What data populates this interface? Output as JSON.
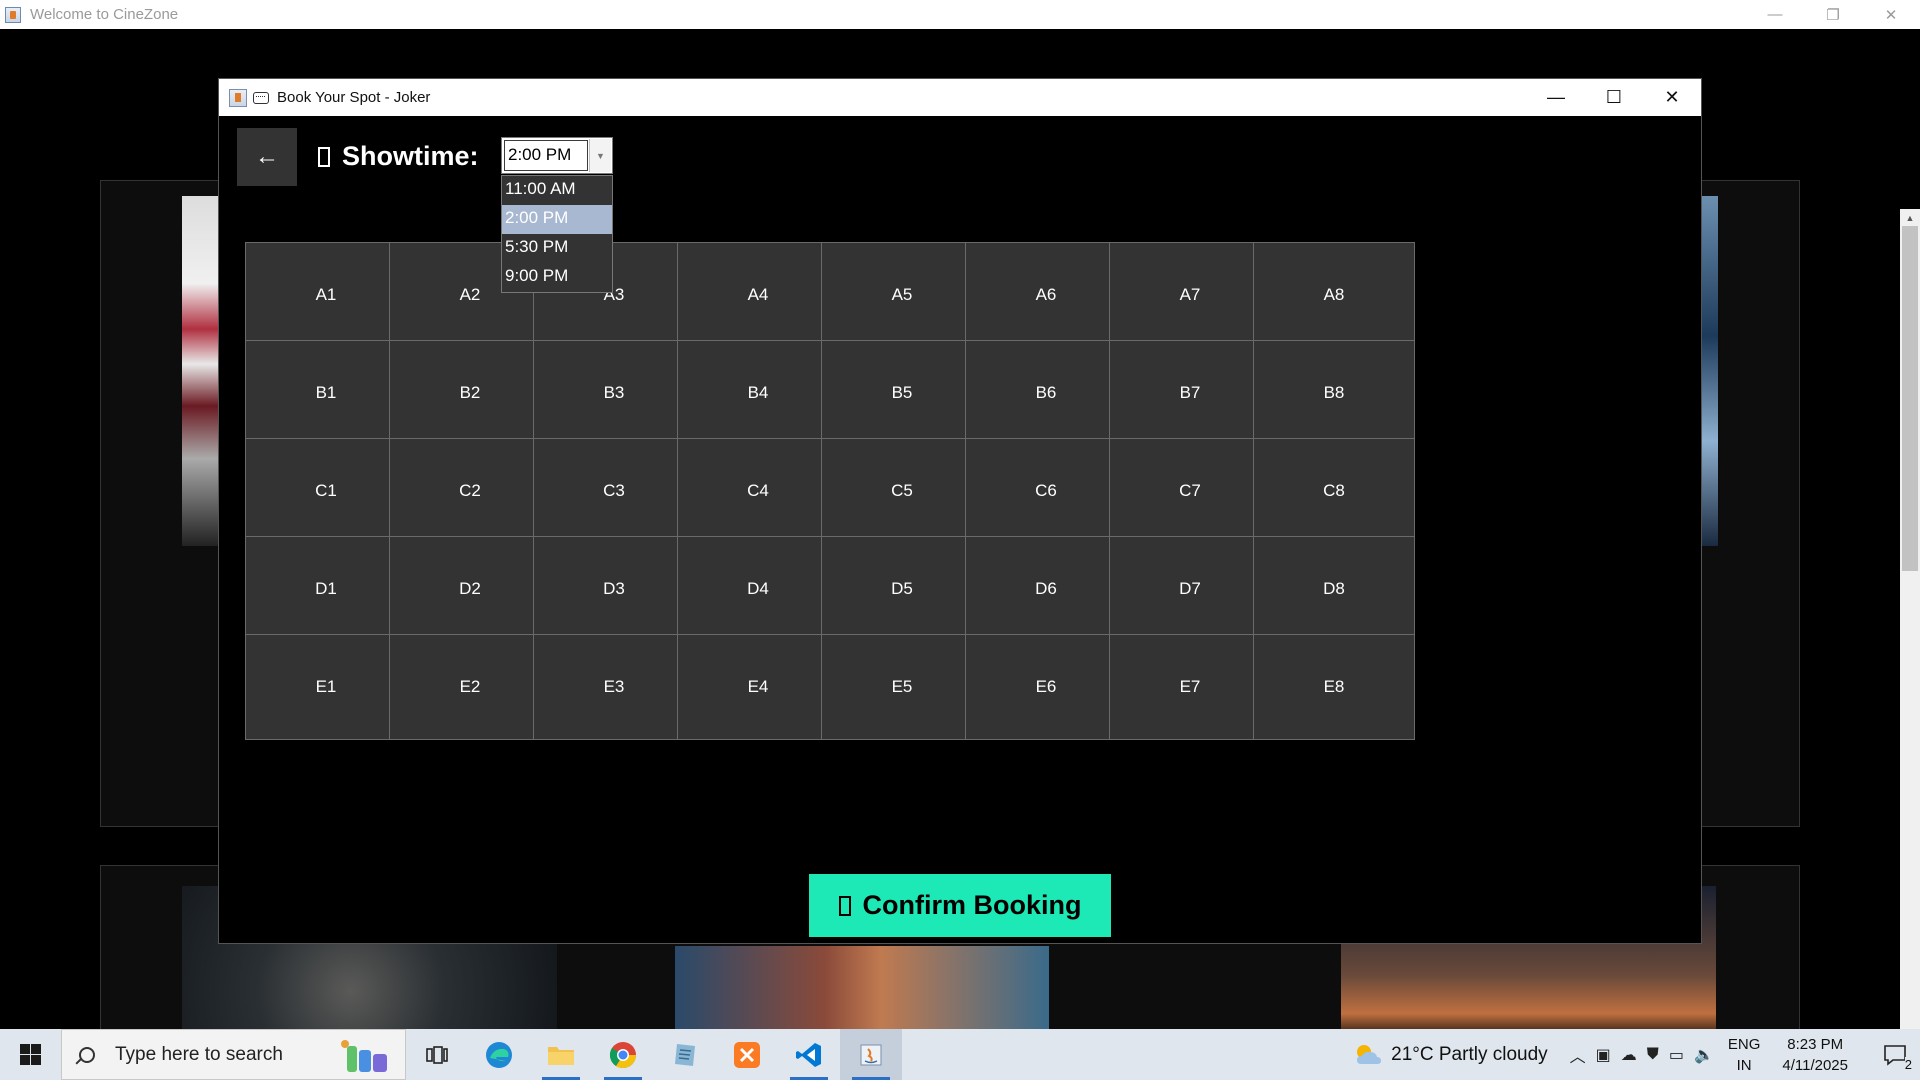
{
  "outer_window": {
    "title": "Welcome to CineZone",
    "controls": {
      "minimize": "—",
      "restore": "❐",
      "close": "✕"
    }
  },
  "dialog": {
    "title": "Book Your Spot - Joker",
    "controls": {
      "minimize": "—",
      "maximize": "☐",
      "close": "✕"
    },
    "back_label": "←",
    "showtime_label": "Showtime:",
    "showtime_selected": "2:00 PM",
    "showtime_options": [
      "11:00 AM",
      "2:00 PM",
      "5:30 PM",
      "9:00 PM"
    ],
    "seat_rows": [
      [
        "A1",
        "A2",
        "A3",
        "A4",
        "A5",
        "A6",
        "A7",
        "A8"
      ],
      [
        "B1",
        "B2",
        "B3",
        "B4",
        "B5",
        "B6",
        "B7",
        "B8"
      ],
      [
        "C1",
        "C2",
        "C3",
        "C4",
        "C5",
        "C6",
        "C7",
        "C8"
      ],
      [
        "D1",
        "D2",
        "D3",
        "D4",
        "D5",
        "D6",
        "D7",
        "D8"
      ],
      [
        "E1",
        "E2",
        "E3",
        "E4",
        "E5",
        "E6",
        "E7",
        "E8"
      ]
    ],
    "confirm_label": "Confirm Booking",
    "colors": {
      "seat_bg": "#333333",
      "confirm_bg": "#1de9b6",
      "selected_option": "#a8b8d0"
    }
  },
  "taskbar": {
    "search_placeholder": "Type here to search",
    "apps": [
      "task-view-icon",
      "edge-icon",
      "file-explorer-icon",
      "chrome-icon",
      "notepad-icon",
      "xampp-icon",
      "vscode-icon",
      "java-icon"
    ],
    "weather_text": "21°C  Partly cloudy",
    "lang_line1": "ENG",
    "lang_line2": "IN",
    "time": "8:23 PM",
    "date": "4/11/2025",
    "notification_count": "2"
  }
}
